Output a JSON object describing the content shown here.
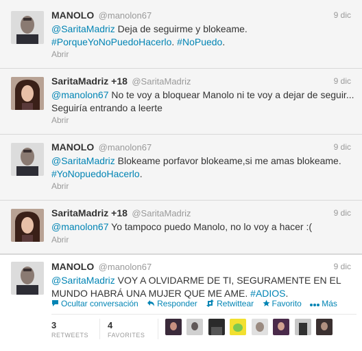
{
  "tweets": [
    {
      "name": "MANOLO",
      "handle": "@manolon67",
      "date": "9 dic",
      "mention": "@SaritaMadriz",
      "body": " Deja de seguirme y blokeame.",
      "hashtag1": "#PorqueYoNoPuedoHacerlo",
      "sep": ". ",
      "hashtag2": "#NoPuedo",
      "end": ".",
      "open": "Abrir"
    },
    {
      "name": "SaritaMadriz +18",
      "handle": "@SaritaMadriz",
      "date": "9 dic",
      "mention": "@manolon67",
      "body": " No te voy a bloquear Manolo ni te voy a dejar de seguir... Seguiría entrando a leerte",
      "open": "Abrir"
    },
    {
      "name": "MANOLO",
      "handle": "@manolon67",
      "date": "9 dic",
      "mention": "@SaritaMadriz",
      "body": " Blokeame porfavor blokeame,si me amas blokeame.",
      "hashtag1": "#YoNopuedoHacerlo",
      "end": ".",
      "open": "Abrir"
    },
    {
      "name": "SaritaMadriz +18",
      "handle": "@SaritaMadriz",
      "date": "9 dic",
      "mention": "@manolon67",
      "body": " Yo tampoco puedo Manolo, no lo voy a hacer :(",
      "open": "Abrir"
    },
    {
      "name": "MANOLO",
      "handle": "@manolon67",
      "date": "9 dic",
      "mention": "@SaritaMadriz",
      "body": " VOY A OLVIDARME DE TI, SEGURAMENTE EN EL MUNDO HABRÁ UNA MUJER QUE ME AME. ",
      "hashtag1": "#ADIOS",
      "end": "."
    }
  ],
  "actions": {
    "collapse": "Ocultar conversación",
    "reply": "Responder",
    "retweet": "Retwittear",
    "favorite": "Favorito",
    "more": "Más"
  },
  "stats": {
    "retweets_count": "3",
    "retweets_label": "RETWEETS",
    "favorites_count": "4",
    "favorites_label": "FAVORITES"
  },
  "colors": {
    "link": "#0084b4",
    "muted": "#999999",
    "collapsed_bg": "#f5f5f5"
  }
}
